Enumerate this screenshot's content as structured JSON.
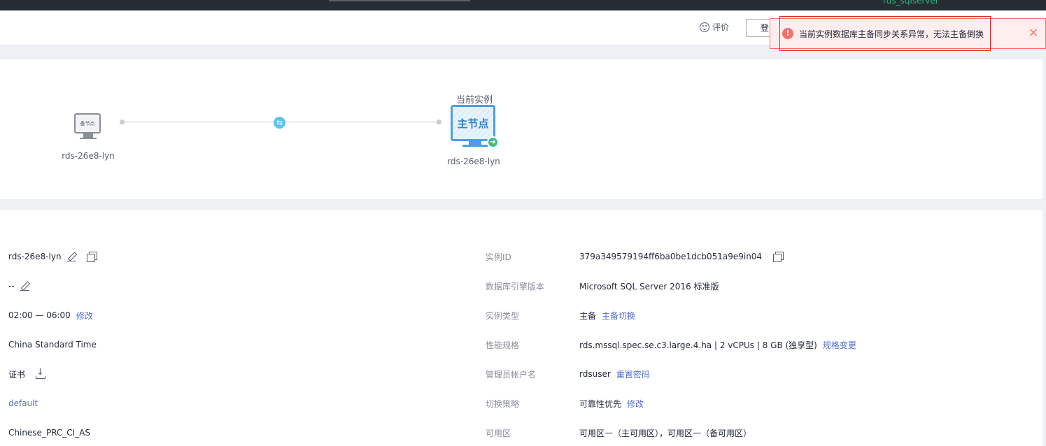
{
  "topbar": {
    "label": "rds_sqlserver"
  },
  "header": {
    "rate_label": "评价",
    "login_label": "登"
  },
  "alert": {
    "icon": "error-icon",
    "message": "当前实例数据库主备同步关系异常，无法主备倒换",
    "close": "×",
    "color": "#f66f6a"
  },
  "topology": {
    "standby": {
      "screen_text": "备节点",
      "name": "rds-26e8-lyn"
    },
    "current_label": "当前实例",
    "primary": {
      "screen_text": "主节点",
      "name": "rds-26e8-lyn"
    },
    "sync_icon": "⇆",
    "badge_icon": "➜"
  },
  "info_left": {
    "name": "rds-26e8-lyn",
    "remark": "--",
    "maintenance_window": "02:00 — 06:00",
    "maintenance_action": "修改",
    "timezone": "China Standard Time",
    "ssl": "证书",
    "param_group": "default",
    "collation": "Chinese_PRC_CI_AS"
  },
  "info_right": {
    "instance_id_label": "实例ID",
    "instance_id": "379a349579194ff6ba0be1dcb051a9e9in04",
    "engine_label": "数据库引擎版本",
    "engine": "Microsoft SQL Server 2016 标准版",
    "type_label": "实例类型",
    "type": "主备",
    "type_action": "主备切换",
    "spec_label": "性能规格",
    "spec": "rds.mssql.spec.se.c3.large.4.ha | 2 vCPUs | 8 GB (独享型)",
    "spec_action": "规格变更",
    "admin_label": "管理员帐户名",
    "admin": "rdsuser",
    "admin_action": "重置密码",
    "switch_label": "切换策略",
    "switch": "可靠性优先",
    "switch_action": "修改",
    "az_label": "可用区",
    "az": "可用区一（主可用区），可用区一（备可用区）"
  }
}
